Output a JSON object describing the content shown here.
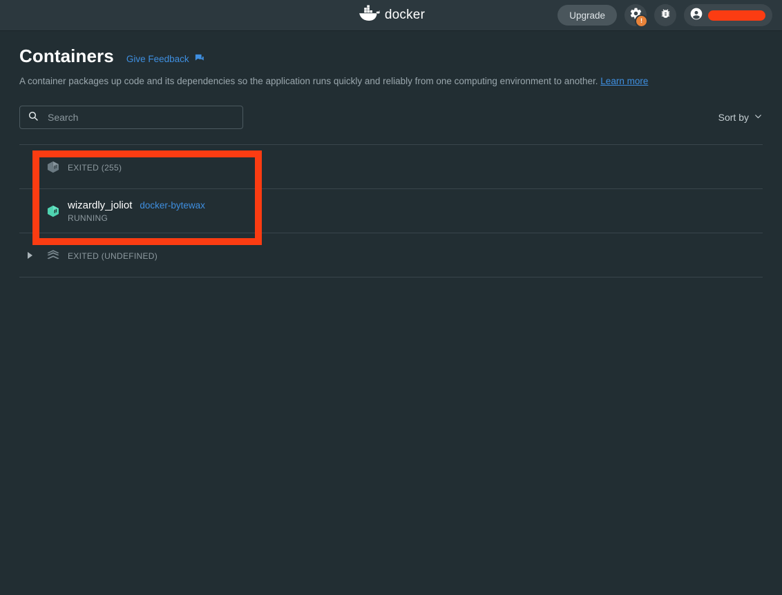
{
  "titlebar": {
    "logo_text": "docker",
    "logo_icon": "docker-whale-icon",
    "upgrade_label": "Upgrade",
    "settings_icon": "gear-icon",
    "settings_badge": "!",
    "debug_icon": "bug-icon",
    "account_icon": "account-circle-icon",
    "account_name_redacted": ""
  },
  "page": {
    "title": "Containers",
    "feedback_label": "Give Feedback",
    "feedback_icon": "feedback-chat-icon",
    "description": "A container packages up code and its dependencies so the application runs quickly and reliably from one computing environment to another.",
    "learn_more_label": "Learn more"
  },
  "toolbar": {
    "search_placeholder": "Search",
    "search_value": "",
    "search_icon": "search-icon",
    "sort_label": "Sort by",
    "sort_icon": "chevron-down-icon"
  },
  "containers": [
    {
      "name": "",
      "image": "",
      "status": "EXITED (255)",
      "icon": "container-icon-stopped",
      "expandable": false
    },
    {
      "name": "wizardly_joliot",
      "image": "docker-bytewax",
      "status": "RUNNING",
      "icon": "container-icon-running",
      "expandable": false
    },
    {
      "name": "",
      "image": "",
      "status": "EXITED (UNDEFINED)",
      "icon": "compose-stack-icon",
      "expandable": true
    }
  ],
  "annotation": {
    "type": "highlight-rectangle",
    "color": "#fb3c12"
  },
  "colors": {
    "background": "#222e33",
    "titlebar": "#2c383e",
    "accent_blue": "#3f8fe0",
    "running_green": "#4fd3b0",
    "badge_orange": "#e8833a",
    "annotation_red": "#fb3c12"
  }
}
